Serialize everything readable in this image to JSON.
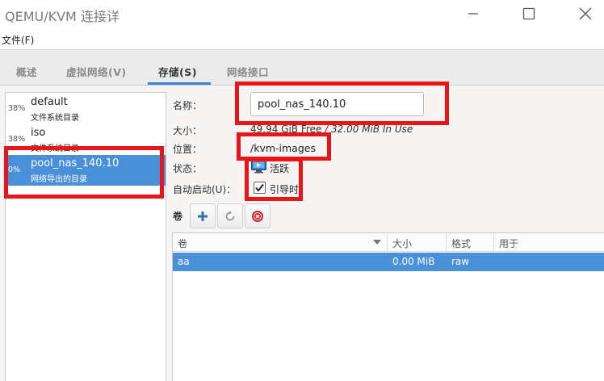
{
  "window": {
    "title": "QEMU/KVM 连接详"
  },
  "menubar": {
    "file_menu": "文件(F)"
  },
  "tabs": [
    {
      "label": "概述",
      "active": false
    },
    {
      "label": "虚拟网络(V)",
      "active": false
    },
    {
      "label": "存储(S)",
      "active": true
    },
    {
      "label": "网络接口",
      "active": false
    }
  ],
  "pools": [
    {
      "percent": "38%",
      "name": "default",
      "type": "文件系统目录",
      "selected": false
    },
    {
      "percent": "38%",
      "name": "iso",
      "type": "文件系统目录",
      "selected": false
    },
    {
      "percent": "0%",
      "name": "pool_nas_140.10",
      "type": "网络导出的目录",
      "selected": true
    }
  ],
  "details": {
    "name_label": "名称：",
    "name_value": "pool_nas_140.10",
    "size_label": "大小：",
    "size_free": "49.94 GiB Free",
    "size_sep": " / ",
    "size_used": "32.00 MiB In Use",
    "location_label": "位置：",
    "location_value": "/kvm-images",
    "state_label": "状态：",
    "state_value": "活跃",
    "autostart_label": "自动启动(U)：",
    "autostart_value": "引导时",
    "autostart_checked": true
  },
  "volumes": {
    "label": "卷",
    "columns": [
      "卷",
      "大小",
      "格式",
      "用于"
    ],
    "rows": [
      {
        "name": "aa",
        "size": "0.00 MiB",
        "format": "raw",
        "used_by": ""
      }
    ]
  },
  "colors": {
    "selection": "#4a90d9",
    "highlight_box": "#e8151a",
    "tab_accent": "#3b82d6"
  }
}
